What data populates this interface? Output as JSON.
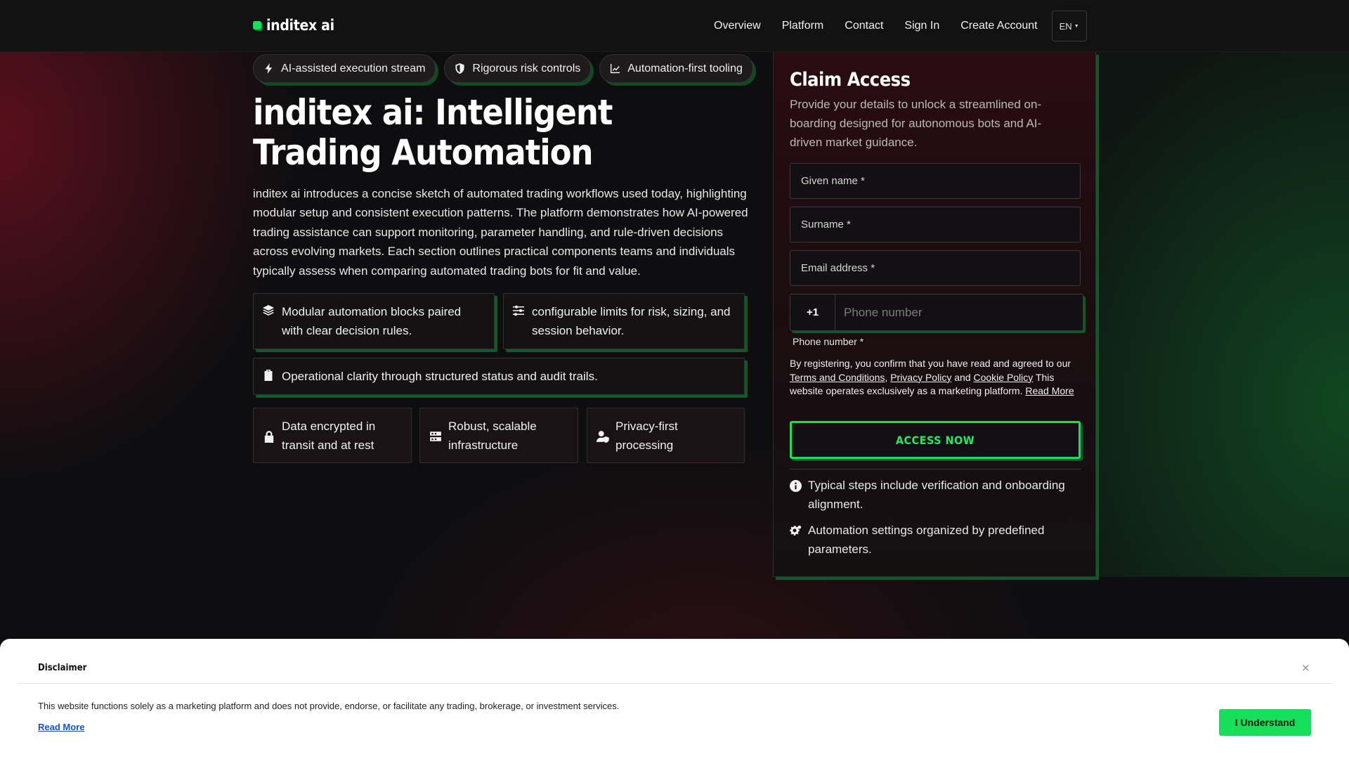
{
  "header": {
    "logo_text": "inditex ai",
    "nav": [
      "Overview",
      "Platform",
      "Contact",
      "Sign In",
      "Create Account"
    ],
    "language": "EN"
  },
  "hero": {
    "pills": [
      {
        "icon": "bolt-icon",
        "label": "AI-assisted execution stream"
      },
      {
        "icon": "shield-icon",
        "label": "Rigorous risk controls"
      },
      {
        "icon": "chart-line-icon",
        "label": "Automation-first tooling"
      }
    ],
    "title": "inditex ai: Intelligent Trading Automation",
    "intro": "inditex ai introduces a concise sketch of automated trading workflows used today, highlighting modular setup and consistent execution patterns. The platform demonstrates how AI-powered trading assistance can support monitoring, parameter handling, and rule-driven decisions across evolving markets. Each section outlines practical components teams and individuals typically assess when comparing automated trading bots for fit and value.",
    "features": [
      {
        "icon": "layers-icon",
        "text": "Modular automation blocks paired with clear decision rules."
      },
      {
        "icon": "sliders-icon",
        "text": "configurable limits for risk, sizing, and session behavior."
      },
      {
        "icon": "clipboard-check-icon",
        "text": "Operational clarity through structured status and audit trails."
      }
    ],
    "badges": [
      {
        "icon": "lock-icon",
        "text": "Data encrypted in transit and at rest"
      },
      {
        "icon": "server-icon",
        "text": "Robust, scalable infrastructure"
      },
      {
        "icon": "user-shield-icon",
        "text": "Privacy-first processing"
      }
    ]
  },
  "form": {
    "title": "Claim Access",
    "description": "Provide your details to unlock a streamlined on-boarding designed for autonomous bots and AI-driven market guidance.",
    "given_name": "Given name *",
    "surname": "Surname *",
    "email": "Email address *",
    "phone_code": "+1",
    "phone_placeholder": "Phone number",
    "phone_label": "Phone number *",
    "legal": {
      "prefix": "By registering, you confirm that you have read and agreed to our",
      "terms": "Terms and Conditions",
      "privacy": "Privacy Policy",
      "and": "and",
      "cookie": "Cookie Policy",
      "suffix": "This website operates exclusively as a marketing platform.",
      "read_more": "Read More"
    },
    "submit": "ACCESS NOW",
    "notes": [
      {
        "icon": "info-icon",
        "text": "Typical steps include verification and onboarding alignment."
      },
      {
        "icon": "gears-icon",
        "text": "Automation settings organized by predefined parameters."
      }
    ]
  },
  "disclaimer": {
    "title": "Disclaimer",
    "close": "×",
    "text": "This website functions solely as a marketing platform and does not provide, endorse, or facilitate any trading, brokerage, or investment services.",
    "read_more": "Read More",
    "button": "I Understand"
  },
  "colors": {
    "accent": "#16e05a",
    "accent_shadow": "#0f5a28",
    "background": "#0e0e10",
    "panel": "#1b0d10"
  }
}
